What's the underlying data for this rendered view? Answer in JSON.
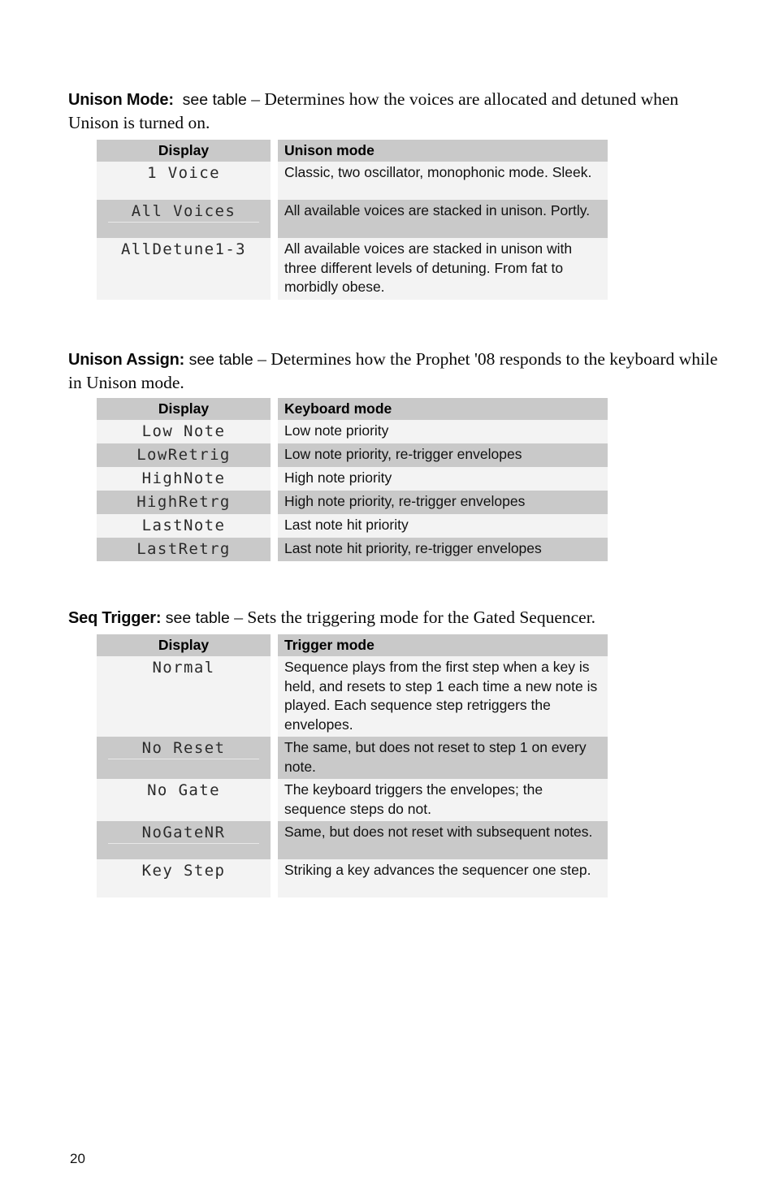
{
  "page": {
    "number": "20"
  },
  "sections": [
    {
      "id": "unison-mode",
      "label": "Unison Mode:",
      "see_table": "see table",
      "description": "– Determines how the voices are allocated and detuned when Unison is turned on.",
      "table": {
        "headers": [
          "Display",
          "Unison mode"
        ],
        "rows": [
          {
            "display": "1 Voice",
            "desc": "Classic, two oscillator, monophonic mode. Sleek."
          },
          {
            "display": "All Voices",
            "desc": "All available voices are stacked in unison. Portly."
          },
          {
            "display": "AllDetune1-3",
            "desc": "All available voices are stacked in unison with three different levels of detuning. From fat to morbidly obese."
          }
        ]
      }
    },
    {
      "id": "unison-assign",
      "label": "Unison Assign:",
      "see_table": "see table",
      "description": "– Determines how the Prophet '08 responds to the keyboard while in Unison mode.",
      "table": {
        "headers": [
          "Display",
          "Keyboard mode"
        ],
        "rows": [
          {
            "display": "Low Note",
            "desc": "Low note priority"
          },
          {
            "display": "LowRetrig",
            "desc": "Low note priority, re-trigger envelopes"
          },
          {
            "display": "HighNote",
            "desc": "High note priority"
          },
          {
            "display": "HighRetrg",
            "desc": "High note priority, re-trigger envelopes"
          },
          {
            "display": "LastNote",
            "desc": "Last note hit priority"
          },
          {
            "display": "LastRetrg",
            "desc": "Last note hit priority, re-trigger envelopes"
          }
        ]
      }
    },
    {
      "id": "seq-trigger",
      "label": "Seq Trigger:",
      "see_table": "see table",
      "description": "– Sets the triggering mode for the Gated Sequencer.",
      "table": {
        "headers": [
          "Display",
          "Trigger mode"
        ],
        "rows": [
          {
            "display": "Normal",
            "desc": "Sequence plays from the first step when a key is held, and resets to step 1 each time a new note is played. Each sequence step retriggers the envelopes."
          },
          {
            "display": "No Reset",
            "desc": "The same, but does not reset to step 1 on every note."
          },
          {
            "display": "No Gate",
            "desc": "The keyboard triggers the envelopes; the sequence steps do not."
          },
          {
            "display": "NoGateNR",
            "desc": "Same, but does not reset with subsequent notes."
          },
          {
            "display": "Key Step",
            "desc": "Striking a key advances the sequencer one step."
          }
        ]
      }
    }
  ]
}
